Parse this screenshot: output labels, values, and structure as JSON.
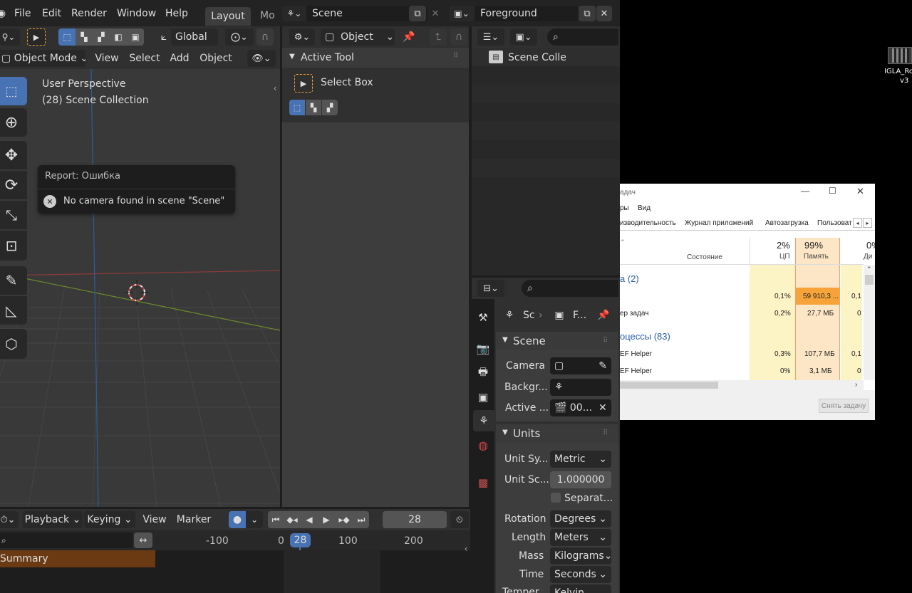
{
  "menu": {
    "file": "File",
    "edit": "Edit",
    "render": "Render",
    "window": "Window",
    "help": "Help"
  },
  "workspace_tabs": {
    "active": "Layout",
    "next": "Mo"
  },
  "scene_field": "Scene",
  "viewlayer_field": "Foreground",
  "viewport": {
    "orientation": "Global",
    "mode": "Object Mode",
    "header_items": {
      "view": "View",
      "select": "Select",
      "add": "Add",
      "object": "Object"
    },
    "overlay_title": "User Perspective",
    "overlay_collection": "(28) Scene Collection"
  },
  "report": {
    "title": "Report: Ошибка",
    "message": "No camera found in scene \"Scene\""
  },
  "tool_settings": {
    "object_field": "Object",
    "section": "Active Tool",
    "tool_name": "Select Box"
  },
  "outliner": {
    "item": "Scene Colle"
  },
  "properties": {
    "breadcrumb_scene": "Sc",
    "breadcrumb_f": "F...",
    "scene_panel": "Scene",
    "camera_label": "Camera",
    "background_label": "Backgr...",
    "active_clip_label": "Active ...",
    "active_clip_value": "00...",
    "units_panel": "Units",
    "unit_system_label": "Unit Sy...",
    "unit_system_value": "Metric",
    "unit_scale_label": "Unit Sc...",
    "unit_scale_value": "1.000000",
    "separate_label": "Separat...",
    "rotation_label": "Rotation",
    "rotation_value": "Degrees",
    "length_label": "Length",
    "length_value": "Meters",
    "mass_label": "Mass",
    "mass_value": "Kilograms",
    "time_label": "Time",
    "time_value": "Seconds",
    "temp_label": "Temper...",
    "temp_value": "Kelvin"
  },
  "timeline": {
    "playback": "Playback",
    "keying": "Keying",
    "view": "View",
    "marker": "Marker",
    "current_frame": "28",
    "ruler": [
      "-100",
      "0",
      "100",
      "200"
    ],
    "playhead": "28",
    "summary": "Summary"
  },
  "task_manager": {
    "title": "адач",
    "menu": [
      "ры",
      "Вид"
    ],
    "tabs": [
      "изводительность",
      "Журнал приложений",
      "Автозагрузка",
      "Пользоват"
    ],
    "columns": {
      "state": "Состояние",
      "cpu_pct": "2%",
      "cpu": "ЦП",
      "mem_pct": "99%",
      "mem": "Память",
      "disk_pct": "0%",
      "disk": "Ди"
    },
    "group1": "а (2)",
    "group2": "оцессы (83)",
    "rows": [
      {
        "name": "",
        "cpu": "0,1%",
        "mem": "59 910,3 ...",
        "disk": "0,1 М"
      },
      {
        "name": "ер задач",
        "cpu": "0,2%",
        "mem": "27,7 МБ",
        "disk": "0 М"
      },
      {
        "name": "EF Helper",
        "cpu": "0,3%",
        "mem": "107,7 МБ",
        "disk": "0,1 М"
      },
      {
        "name": "EF Helper",
        "cpu": "0%",
        "mem": "3,1 МБ",
        "disk": "0 М"
      }
    ],
    "end_task": "Снять задачу"
  },
  "desktop_icon": {
    "line1": "IGLA_Ro",
    "line2": "v3"
  },
  "colors": {
    "accent": "#4772b3",
    "mem_high": "#f6a43a",
    "mem_col": "#fde6c6",
    "cpu_col": "#fdf4c6"
  }
}
